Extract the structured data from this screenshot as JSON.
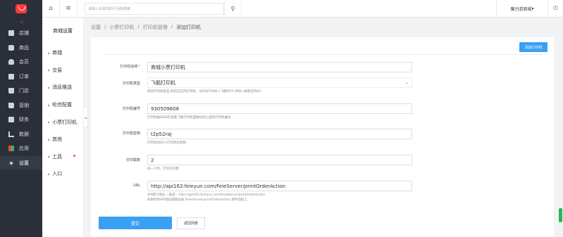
{
  "sidebar": {
    "collapse_label": "◁",
    "items": [
      {
        "label": "店铺",
        "icon": "shop-icon"
      },
      {
        "label": "商品",
        "icon": "goods-icon"
      },
      {
        "label": "会员",
        "icon": "member-icon"
      },
      {
        "label": "订单",
        "icon": "order-icon"
      },
      {
        "label": "门店",
        "icon": "store-icon"
      },
      {
        "label": "营销",
        "icon": "marketing-icon"
      },
      {
        "label": "财务",
        "icon": "finance-icon"
      },
      {
        "label": "数据",
        "icon": "data-icon"
      },
      {
        "label": "应用",
        "icon": "apps-icon"
      },
      {
        "label": "设置",
        "icon": "settings-icon"
      }
    ]
  },
  "topbar": {
    "search_placeholder": "请输入关键词的行功能搜索...",
    "store_name": "魔力游商城",
    "store_caret": "▾"
  },
  "subnav": {
    "title": "商城设置",
    "items": [
      "商城",
      "交易",
      "消息推送",
      "轮信配置",
      "小票打印机",
      "其他",
      "工具",
      "入口"
    ]
  },
  "breadcrumb": [
    "设置",
    "小票打印机",
    "打印机管理",
    "添加打印机"
  ],
  "form": {
    "add_button": "添加打印机",
    "name": {
      "label": "打印机名称",
      "value": "商城小票打印机"
    },
    "type": {
      "label": "打印机类型",
      "value": "飞鹅打印机",
      "hint": "目前打印机类型,目前已支持打印机：365的ITSBK→飞鹅的FP-58W→易联云的K3"
    },
    "code": {
      "label": "打印机编号",
      "value": "930509608",
      "hint": "打印机编号SN在查看飞鹅打印机面板标明上面的打印机编号"
    },
    "key": {
      "label": "打印机密钥",
      "value": "t2p52raj",
      "hint": "打印机的KEY,打印机的密钥"
    },
    "copies": {
      "label": "打印联数",
      "value": "2",
      "hint": "同一订单，打印的次数"
    },
    "url": {
      "label": "URL",
      "value": "http://api163.feieyun.com/FeieServer/printOrderAction",
      "hint1": "API接口地址 一般是：http://api163.feieyun.com/FeieServer/printOrderAction",
      "hint2": "如果你的API地址跟随设备 /FeieServer/printOrderAction,请手动加上"
    },
    "submit": "提交",
    "back": "返回列表"
  },
  "colors": {
    "primary": "#3aa0f3",
    "sidebar": "#2b2f3a",
    "logo": "#ff3b3b"
  }
}
